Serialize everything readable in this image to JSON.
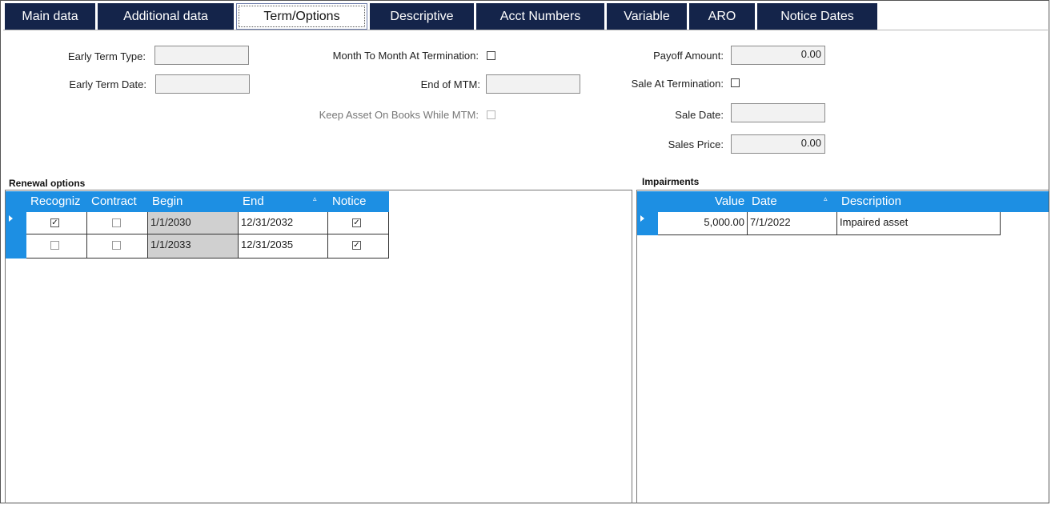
{
  "tabs": [
    {
      "label": "Main data"
    },
    {
      "label": "Additional data"
    },
    {
      "label": "Term/Options",
      "active": true
    },
    {
      "label": "Descriptive"
    },
    {
      "label": "Acct Numbers"
    },
    {
      "label": "Variable"
    },
    {
      "label": "ARO"
    },
    {
      "label": "Notice Dates"
    }
  ],
  "form": {
    "early_term_type_label": "Early Term Type:",
    "early_term_type_value": "",
    "early_term_date_label": "Early Term Date:",
    "early_term_date_value": "",
    "mtm_at_termination_label": "Month To Month At Termination:",
    "mtm_at_termination_checked": false,
    "end_of_mtm_label": "End of MTM:",
    "end_of_mtm_value": "",
    "keep_asset_label": "Keep Asset On Books While MTM:",
    "keep_asset_checked": false,
    "payoff_amount_label": "Payoff Amount:",
    "payoff_amount_value": "0.00",
    "sale_at_termination_label": "Sale At Termination:",
    "sale_at_termination_checked": false,
    "sale_date_label": "Sale Date:",
    "sale_date_value": "",
    "sales_price_label": "Sales Price:",
    "sales_price_value": "0.00"
  },
  "renewal": {
    "title": "Renewal options",
    "columns": {
      "recogniz": "Recogniz",
      "contract": "Contract",
      "begin": "Begin",
      "end": "End",
      "notice": "Notice"
    },
    "sort_indicator": "▵",
    "rows": [
      {
        "recogniz": true,
        "contract": false,
        "begin": "1/1/2030",
        "end": "12/31/2032",
        "notice": true
      },
      {
        "recogniz": false,
        "contract": false,
        "begin": "1/1/2033",
        "end": "12/31/2035",
        "notice": true
      }
    ]
  },
  "impairments": {
    "title": "Impairments",
    "columns": {
      "value": "Value",
      "date": "Date",
      "description": "Description"
    },
    "sort_indicator": "▵",
    "rows": [
      {
        "value": "5,000.00",
        "date": "7/1/2022",
        "description": "Impaired asset"
      }
    ]
  },
  "check_glyph": "✓",
  "colors": {
    "tab_bg": "#14244a",
    "grid_header": "#1d8fe3",
    "readonly_cell": "#d0d0d0"
  }
}
